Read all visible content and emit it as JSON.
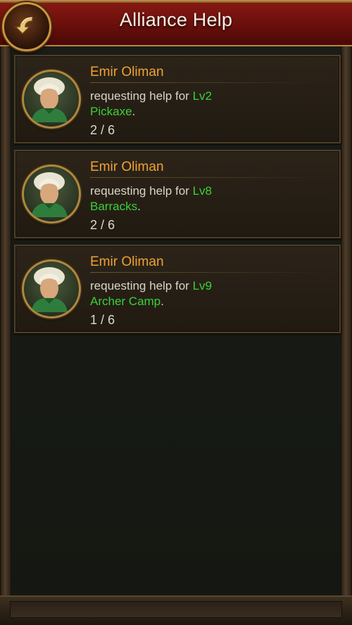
{
  "header": {
    "title": "Alliance Help"
  },
  "requests": [
    {
      "player": "Emir Oliman",
      "prefix": "requesting help for",
      "level": "Lv2",
      "building": "Pickaxe",
      "suffix": ".",
      "progress": "2 / 6"
    },
    {
      "player": "Emir Oliman",
      "prefix": "requesting help for",
      "level": "Lv8",
      "building": "Barracks",
      "suffix": ".",
      "progress": "2 / 6"
    },
    {
      "player": "Emir Oliman",
      "prefix": "requesting help for",
      "level": "Lv9",
      "building": "Archer Camp",
      "suffix": ".",
      "progress": "1 / 6"
    }
  ],
  "icons": {
    "back": "back-arrow-icon",
    "avatar": "player-avatar"
  },
  "colors": {
    "name": "#f0a233",
    "highlight": "#39d13a",
    "header": "#7a130e"
  }
}
